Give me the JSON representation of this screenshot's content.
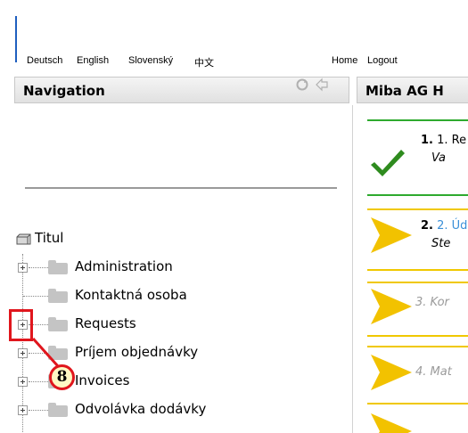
{
  "languages": [
    "Deutsch",
    "English",
    "Slovenský",
    "中文"
  ],
  "top_links": {
    "home": "Home",
    "logout": "Logout"
  },
  "navigation": {
    "title": "Navigation",
    "tree": {
      "root": "Titul",
      "items": [
        {
          "label": "Administration",
          "expandable": true
        },
        {
          "label": "Kontaktná osoba",
          "expandable": false
        },
        {
          "label": "Requests",
          "expandable": true
        },
        {
          "label": "Príjem objednávky",
          "expandable": true
        },
        {
          "label": "Invoices",
          "expandable": true
        },
        {
          "label": "Odvolávka dodávky",
          "expandable": true
        }
      ]
    }
  },
  "callout": {
    "number": "8"
  },
  "right_panel": {
    "title": "Miba AG H",
    "steps": [
      {
        "num": "1. Re",
        "sub": "Va",
        "status": "done"
      },
      {
        "num": "2. Úd",
        "sub": "Ste",
        "status": "current"
      },
      {
        "num": "3. Kor",
        "status": "pending"
      },
      {
        "num": "4. Mat",
        "status": "pending"
      }
    ]
  },
  "colors": {
    "accent_red": "#e0161d",
    "check_green": "#2e8b1e",
    "arrow_yellow": "#f2c200",
    "rule_green": "#2eaa2e",
    "rule_yellow": "#f0c800"
  }
}
